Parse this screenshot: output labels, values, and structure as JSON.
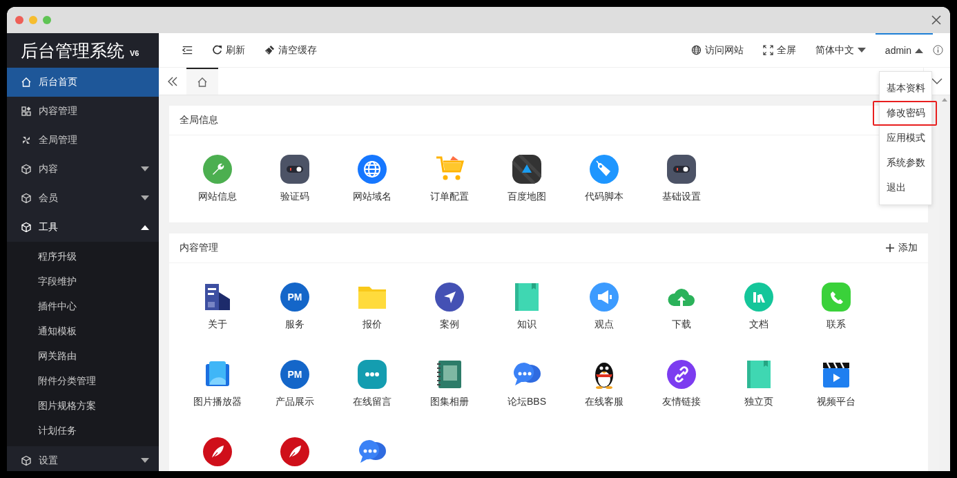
{
  "sidebar": {
    "title": "后台管理系统",
    "version": "V6",
    "items": [
      {
        "label": "后台首页",
        "kind": "home",
        "selected": true
      },
      {
        "label": "内容管理",
        "kind": "grid",
        "selected": false
      },
      {
        "label": "全局管理",
        "kind": "fan",
        "selected": false
      },
      {
        "label": "内容",
        "kind": "cube",
        "selected": false,
        "expanded": false
      },
      {
        "label": "会员",
        "kind": "cube",
        "selected": false,
        "expanded": false
      },
      {
        "label": "工具",
        "kind": "cube",
        "selected": false,
        "expanded": true,
        "children": [
          {
            "label": "程序升级",
            "selected": false
          },
          {
            "label": "字段维护",
            "selected": false
          },
          {
            "label": "插件中心",
            "selected": false
          },
          {
            "label": "通知模板",
            "selected": false
          },
          {
            "label": "网关路由",
            "selected": false
          },
          {
            "label": "附件分类管理",
            "selected": false
          },
          {
            "label": "图片规格方案",
            "selected": false
          },
          {
            "label": "计划任务",
            "selected": false
          }
        ]
      },
      {
        "label": "设置",
        "kind": "cube",
        "selected": false,
        "expanded": false
      }
    ]
  },
  "toolbar": {
    "left": [
      {
        "label": "刷新",
        "kind": "refresh"
      },
      {
        "label": "清空缓存",
        "kind": "brush"
      }
    ],
    "right": [
      {
        "label": "访问网站",
        "kind": "globe"
      },
      {
        "label": "全屏",
        "kind": "fullscreen"
      },
      {
        "label": "简体中文",
        "kind": "dropdown",
        "expanded": false,
        "selected": false
      },
      {
        "label": "admin",
        "kind": "dropdown",
        "expanded": true,
        "selected": true
      }
    ]
  },
  "tabs": [
    {
      "kind": "home",
      "selected": true
    }
  ],
  "user_menu": {
    "items": [
      {
        "label": "基本资料",
        "selected": false
      },
      {
        "label": "修改密码",
        "selected": true
      },
      {
        "label": "应用模式",
        "selected": false
      },
      {
        "label": "系统参数",
        "selected": false
      },
      {
        "label": "退出",
        "selected": false
      }
    ]
  },
  "panels": [
    {
      "title": "全局信息",
      "tiles": [
        {
          "label": "网站信息",
          "kind": "wrench"
        },
        {
          "label": "验证码",
          "kind": "toggle"
        },
        {
          "label": "网站域名",
          "kind": "globe"
        },
        {
          "label": "订单配置",
          "kind": "cart"
        },
        {
          "label": "百度地图",
          "kind": "map"
        },
        {
          "label": "代码脚本",
          "kind": "tag"
        },
        {
          "label": "基础设置",
          "kind": "toggle"
        }
      ]
    },
    {
      "title": "内容管理",
      "action": "添加",
      "tiles": [
        {
          "label": "关于",
          "kind": "building"
        },
        {
          "label": "服务",
          "kind": "pm",
          "badge": "PM"
        },
        {
          "label": "报价",
          "kind": "folder"
        },
        {
          "label": "案例",
          "kind": "send"
        },
        {
          "label": "知识",
          "kind": "book"
        },
        {
          "label": "观点",
          "kind": "megaphone"
        },
        {
          "label": "下载",
          "kind": "cloud"
        },
        {
          "label": "文档",
          "kind": "bars"
        },
        {
          "label": "联系",
          "kind": "phone"
        },
        {
          "label": "图片播放器",
          "kind": "photos"
        },
        {
          "label": "产品展示",
          "kind": "pm",
          "badge": "PM"
        },
        {
          "label": "在线留言",
          "kind": "dots"
        },
        {
          "label": "图集相册",
          "kind": "album"
        },
        {
          "label": "论坛BBS",
          "kind": "bubbles"
        },
        {
          "label": "在线客服",
          "kind": "penguin"
        },
        {
          "label": "友情链接",
          "kind": "link"
        },
        {
          "label": "独立页",
          "kind": "book"
        },
        {
          "label": "视频平台",
          "kind": "video"
        },
        {
          "kind": "feather"
        },
        {
          "kind": "feather"
        },
        {
          "kind": "bubbles"
        }
      ]
    }
  ]
}
